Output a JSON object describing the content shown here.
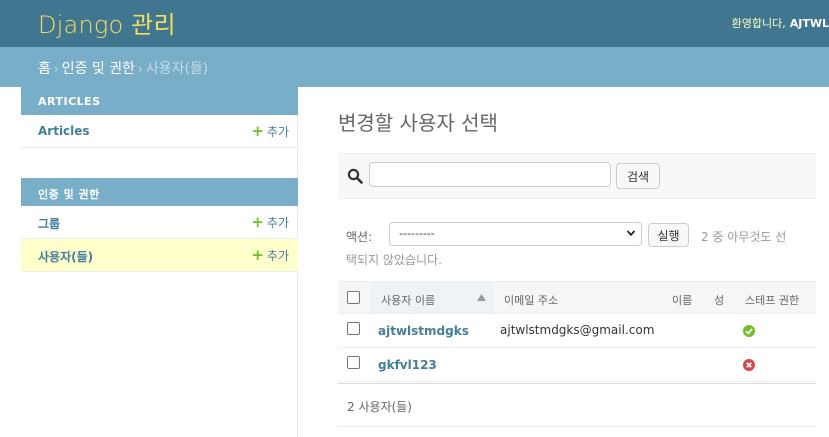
{
  "header": {
    "site_title": "Django 관리",
    "welcome": "환영합니다,",
    "username": "AJTWL"
  },
  "breadcrumbs": {
    "home": "홈",
    "app": "인증 및 권한",
    "current": "사용자(들)",
    "separator": "›"
  },
  "sidebar": {
    "modules": [
      {
        "caption": "ARTICLES",
        "rows": [
          {
            "label": "Articles",
            "add": "추가"
          }
        ]
      },
      {
        "caption": "인증 및 권한",
        "rows": [
          {
            "label": "그룹",
            "add": "추가"
          },
          {
            "label": "사용자(들)",
            "add": "추가"
          }
        ]
      }
    ]
  },
  "main": {
    "title": "변경할 사용자 선택",
    "search": {
      "value": "",
      "button": "검색"
    },
    "actions": {
      "label": "액션:",
      "selected": "---------",
      "go": "실행",
      "counter_line1": "2 중 아무것도 선",
      "counter_line2": "택되지 않았습니다."
    },
    "table": {
      "columns": [
        "사용자 이름",
        "이메일 주소",
        "이름",
        "성",
        "스테프 권한"
      ],
      "rows": [
        {
          "username": "ajtwlstmdgks",
          "email": "ajtwlstmdgks@gmail.com",
          "first_name": "",
          "last_name": "",
          "is_staff": true
        },
        {
          "username": "gkfvl123",
          "email": "",
          "first_name": "",
          "last_name": "",
          "is_staff": false
        }
      ]
    },
    "paginator": "2 사용자(들)"
  },
  "colors": {
    "header_bg": "#417690",
    "branding": "#f5dd5d",
    "breadcrumbs_bg": "#79aec8",
    "link": "#447e9b",
    "add_plus": "#70bf2b",
    "current_row_bg": "#ffffcc",
    "staff_yes": "#70bf2b",
    "staff_no": "#dd4646"
  }
}
